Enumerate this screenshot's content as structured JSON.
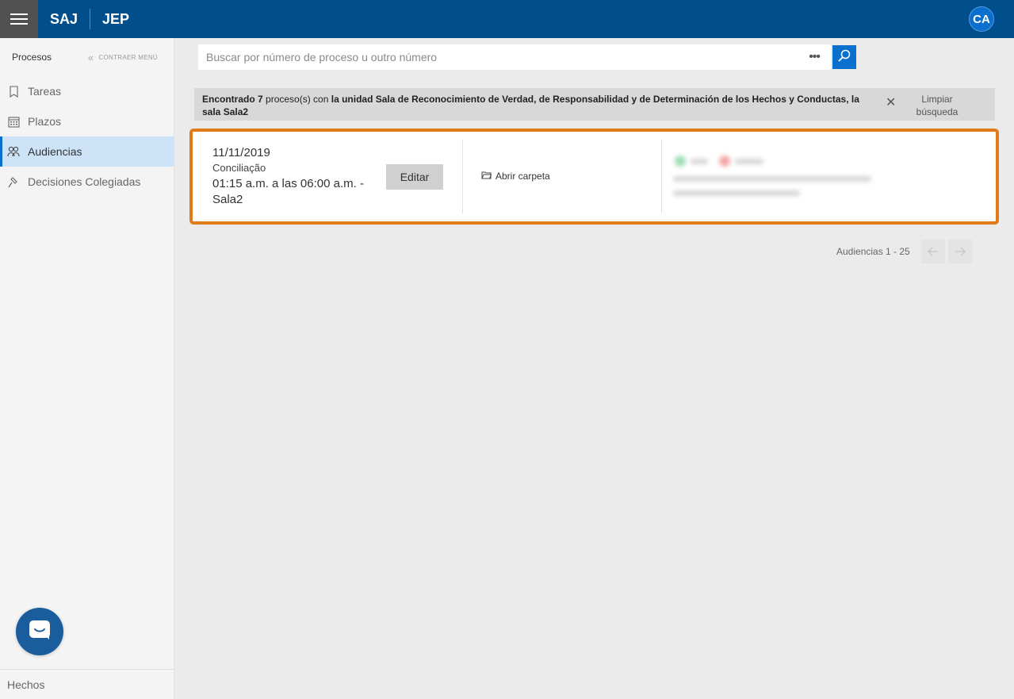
{
  "header": {
    "brand_primary": "SAJ",
    "brand_secondary": "JEP",
    "avatar_initials": "CA",
    "colors": {
      "bar": "#004e8c",
      "accent": "#0b6fce"
    }
  },
  "sidebar": {
    "section_title": "Procesos",
    "collapse_label": "CONTRAER MENÚ",
    "items": [
      {
        "label": "Tareas",
        "icon": "bookmark-icon",
        "active": false
      },
      {
        "label": "Plazos",
        "icon": "calendar-icon",
        "active": false
      },
      {
        "label": "Audiencias",
        "icon": "people-icon",
        "active": true
      },
      {
        "label": "Decisiones Colegiadas",
        "icon": "gavel-icon",
        "active": false
      }
    ],
    "footer_label": "Hechos"
  },
  "search": {
    "placeholder": "Buscar por número de proceso u outro número",
    "more_label": "•••"
  },
  "filter": {
    "prefix": "Encontrado 7",
    "middle": " proceso(s) con ",
    "detail": "la unidad Sala de Reconocimiento de Verdad, de Responsabilidad y de Determinación de los Hechos y Conductas, la sala Sala2",
    "clear_label": "Limpiar búsqueda"
  },
  "result": {
    "date": "11/11/2019",
    "type": "Conciliação",
    "time": "01:15 a.m. a las 06:00 a.m. - Sala2",
    "edit_label": "Editar",
    "open_folder_label": "Abrir carpeta",
    "highlight_color": "#e07b1a"
  },
  "pagination": {
    "label": "Audiencias 1 - 25"
  }
}
